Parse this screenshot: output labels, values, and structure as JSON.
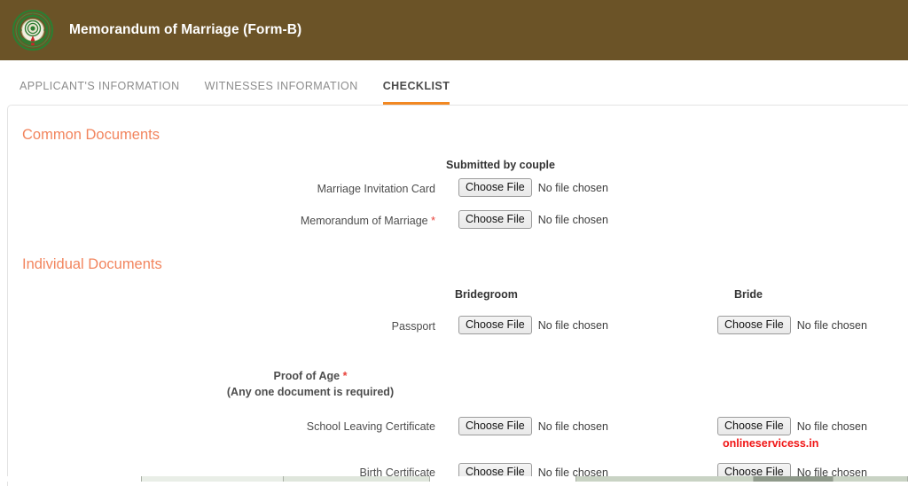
{
  "header": {
    "title": "Memorandum of Marriage (Form-B)",
    "emblem_icon": "andhra-pradesh-government-emblem",
    "background_color": "#6b5327"
  },
  "tabs": [
    {
      "label": "APPLICANT'S INFORMATION",
      "active": false
    },
    {
      "label": "WITNESSES INFORMATION",
      "active": false
    },
    {
      "label": "CHECKLIST",
      "active": true
    }
  ],
  "active_tab_underline_color": "#f28822",
  "section_title_color": "#f2855e",
  "file_input": {
    "button_label": "Choose File",
    "status_text": "No file chosen"
  },
  "common_documents": {
    "title": "Common Documents",
    "column_header": "Submitted by couple",
    "rows": [
      {
        "label": "Marriage Invitation Card",
        "required": false
      },
      {
        "label": "Memorandum of Marriage",
        "required": true
      }
    ]
  },
  "individual_documents": {
    "title": "Individual Documents",
    "column_headers": [
      "Bridegroom",
      "Bride"
    ],
    "rows": [
      {
        "label": "Passport",
        "required": false
      }
    ],
    "proof_of_age": {
      "label": "Proof of Age",
      "required": true,
      "note": "(Any one document is required)",
      "rows": [
        {
          "label": "School Leaving Certificate",
          "required": false
        },
        {
          "label": "Birth Certificate",
          "required": false
        }
      ]
    }
  },
  "watermark": {
    "text": "onlineservicess.in",
    "color": "#f01414"
  },
  "required_marker": "*"
}
